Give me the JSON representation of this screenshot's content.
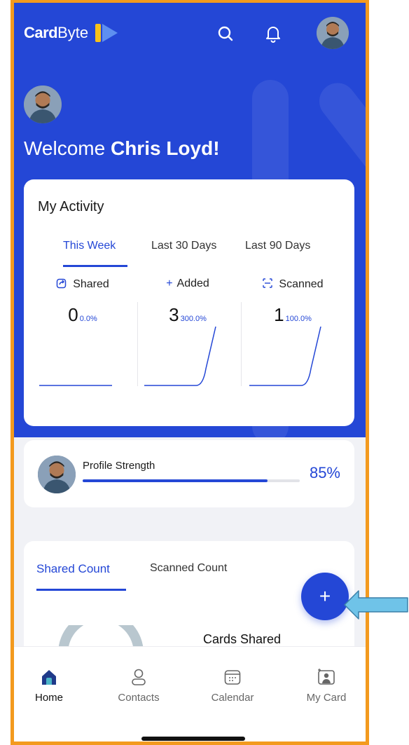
{
  "app": {
    "brand_bold": "Card",
    "brand_light": "Byte"
  },
  "topbar": {
    "icons": [
      "search-icon",
      "bell-icon",
      "avatar"
    ]
  },
  "welcome": {
    "prefix": "Welcome",
    "name": "Chris Loyd!"
  },
  "activity": {
    "title": "My Activity",
    "tabs": [
      {
        "label": "This Week",
        "active": true
      },
      {
        "label": "Last 30 Days",
        "active": false
      },
      {
        "label": "Last 90 Days",
        "active": false
      }
    ],
    "metrics": [
      {
        "label": "Shared",
        "icon": "share-icon",
        "value": "0",
        "pct": "0.0%"
      },
      {
        "label": "Added",
        "icon": "plus-icon",
        "value": "3",
        "pct": "300.0%"
      },
      {
        "label": "Scanned",
        "icon": "scan-icon",
        "value": "1",
        "pct": "100.0%"
      }
    ]
  },
  "profile_strength": {
    "label": "Profile Strength",
    "percent_text": "85%",
    "percent": 85
  },
  "counts": {
    "tabs": [
      {
        "label": "Shared Count",
        "active": true
      },
      {
        "label": "Scanned Count",
        "active": false
      }
    ],
    "cards_shared_label": "Cards Shared"
  },
  "fab": {
    "label": "+"
  },
  "bottom_nav": [
    {
      "label": "Home",
      "icon": "home-icon",
      "active": true
    },
    {
      "label": "Contacts",
      "icon": "contacts-icon",
      "active": false
    },
    {
      "label": "Calendar",
      "icon": "calendar-icon",
      "active": false
    },
    {
      "label": "My Card",
      "icon": "my-card-icon",
      "active": false
    }
  ],
  "colors": {
    "primary": "#2447d6",
    "frame": "#f39a1e",
    "arrow": "#6fc3e8"
  }
}
